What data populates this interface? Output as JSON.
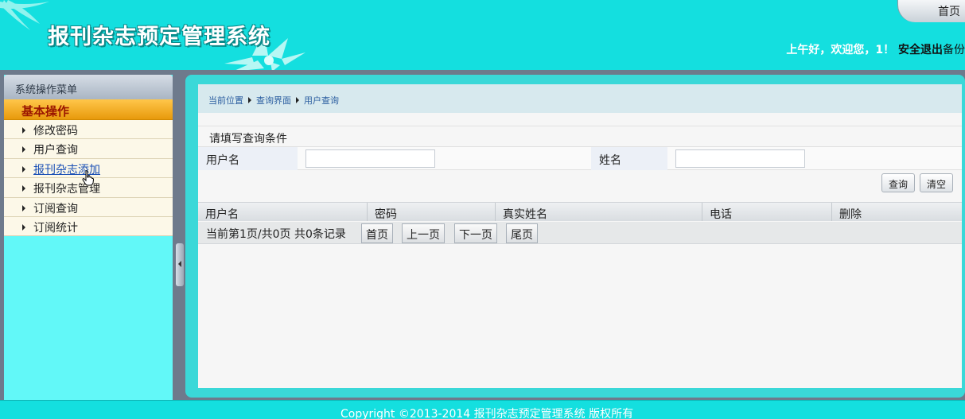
{
  "header": {
    "logo_text": "报刊杂志预定管理系统",
    "home_tab": "首页",
    "greeting": "上午好，欢迎您，1！",
    "logout": "安全退出",
    "backup": "备份"
  },
  "sidebar": {
    "menu_title": "系统操作菜单",
    "group_title": "基本操作",
    "items": [
      {
        "label": "修改密码"
      },
      {
        "label": "用户查询"
      },
      {
        "label": "报刊杂志添加"
      },
      {
        "label": "报刊杂志管理"
      },
      {
        "label": "订阅查询"
      },
      {
        "label": "订阅统计"
      }
    ]
  },
  "breadcrumb": [
    "当前位置",
    "查询界面",
    "用户查询"
  ],
  "query": {
    "title": "请填写查询条件",
    "username_label": "用户名",
    "username_value": "",
    "realname_label": "姓名",
    "realname_value": "",
    "search_button": "查询",
    "clear_button": "清空"
  },
  "table": {
    "columns": [
      "用户名",
      "密码",
      "真实姓名",
      "电话",
      "删除"
    ],
    "rows": []
  },
  "pager": {
    "info": "当前第1页/共0页  共0条记录",
    "first": "首页",
    "prev": "上一页",
    "next": "下一页",
    "last": "尾页"
  },
  "footer": {
    "copyright": "Copyright ©2013-2014 报刊杂志预定管理系统 版权所有"
  },
  "colors": {
    "header_bg": "#14dfdf",
    "sidebar_bg": "#62f8f8",
    "group_header": "#f0a818",
    "link_active": "#1a4fb5"
  }
}
